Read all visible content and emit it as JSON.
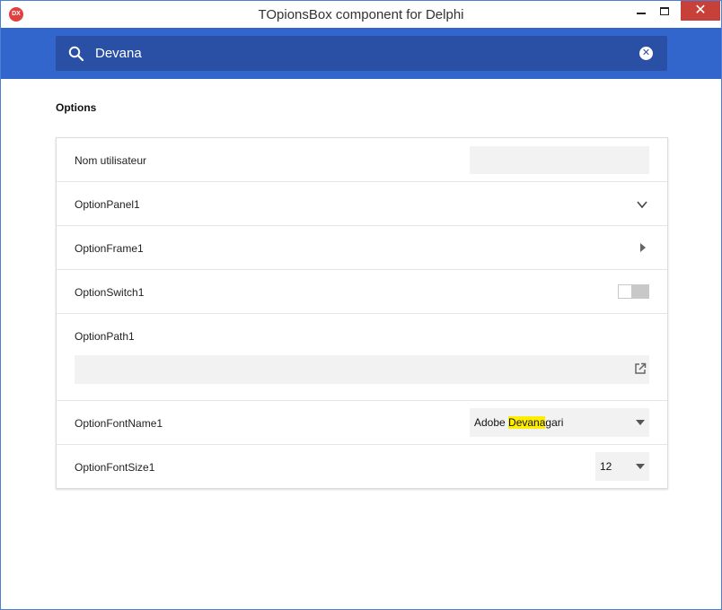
{
  "window": {
    "title": "TOpionsBox component for Delphi",
    "app_icon_text": "DX",
    "close_glyph": "✕"
  },
  "search": {
    "value": "Devana",
    "clear_glyph": "✕"
  },
  "section": {
    "title": "Options"
  },
  "options": {
    "user_name": {
      "label": "Nom utilisateur",
      "value": ""
    },
    "panel": {
      "label": "OptionPanel1"
    },
    "frame": {
      "label": "OptionFrame1"
    },
    "switch": {
      "label": "OptionSwitch1"
    },
    "path": {
      "label": "OptionPath1",
      "value": ""
    },
    "font_name": {
      "label": "OptionFontName1",
      "value_prefix": "Adobe ",
      "value_match": "Devana",
      "value_suffix": "gari"
    },
    "font_size": {
      "label": "OptionFontSize1",
      "value": "12"
    }
  },
  "colors": {
    "accent": "#3366cc",
    "search_box": "#2a50a6",
    "close_button": "#c7403a",
    "match_highlight": "#ffee00"
  },
  "icons": [
    "search-icon",
    "clear-icon",
    "chevron-down-icon",
    "chevron-right-icon",
    "open-external-icon",
    "dropdown-arrow-icon"
  ]
}
